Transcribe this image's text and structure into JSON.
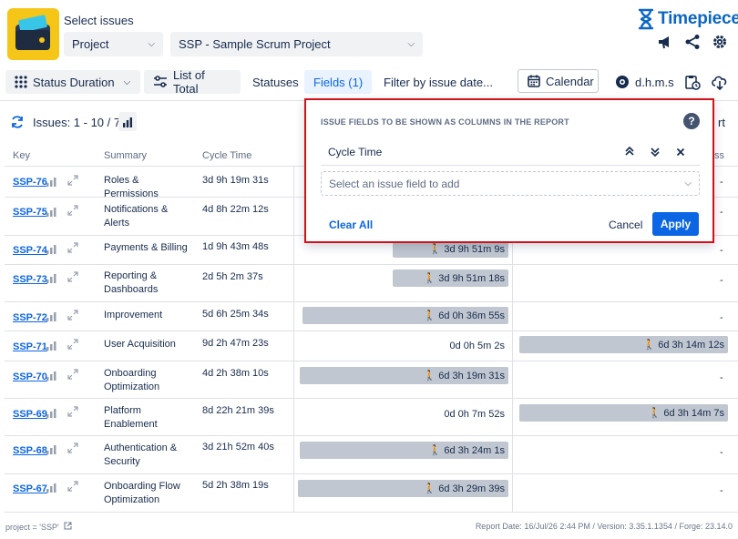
{
  "header": {
    "select_label": "Select issues",
    "project_dropdown": "Project",
    "project_value": "SSP - Sample Scrum Project",
    "brand_name": "Timepiece"
  },
  "toolbar": {
    "status_duration": "Status Duration",
    "list_of_total": "List of Total",
    "statuses": "Statuses",
    "fields": "Fields (1)",
    "filter": "Filter by issue date...",
    "calendar": "Calendar",
    "time_format": "d.h.m.s"
  },
  "issues": {
    "count": "Issues: 1 - 10 / 76",
    "partial_right": "rt",
    "partial_col": "ss"
  },
  "table": {
    "headers": {
      "key": "Key",
      "summary": "Summary",
      "cycle_time": "Cycle Time"
    },
    "rows": [
      {
        "key": "SSP-76",
        "summary": "Roles & Permissions",
        "cycle": "3d 9h 19m 31s",
        "mid": "",
        "right": "-"
      },
      {
        "key": "SSP-75",
        "summary": "Notifications & Alerts",
        "cycle": "4d 8h 22m 12s",
        "mid": "",
        "right": "-"
      },
      {
        "key": "SSP-74",
        "summary": "Payments & Billing",
        "cycle": "1d 9h 43m 48s",
        "mid": "3d 9h 51m 9s",
        "right": "-"
      },
      {
        "key": "SSP-73",
        "summary": "Reporting & Dashboards",
        "cycle": "2d 5h 2m 37s",
        "mid": "3d 9h 51m 18s",
        "right": "-"
      },
      {
        "key": "SSP-72",
        "summary": "Improvement",
        "cycle": "5d 6h 25m 34s",
        "mid": "6d 0h 36m 55s",
        "right": "-"
      },
      {
        "key": "SSP-71",
        "summary": "User Acquisition",
        "cycle": "9d 2h 47m 23s",
        "mid": "0d 0h 5m 2s",
        "right": "6d 3h 14m 12s"
      },
      {
        "key": "SSP-70",
        "summary": "Onboarding Optimization",
        "cycle": "4d 2h 38m 10s",
        "mid": "6d 3h 19m 31s",
        "right": "-"
      },
      {
        "key": "SSP-69",
        "summary": "Platform Enablement",
        "cycle": "8d 22h 21m 39s",
        "mid": "0d 0h 7m 52s",
        "right": "6d 3h 14m 7s"
      },
      {
        "key": "SSP-68",
        "summary": "Authentication & Security",
        "cycle": "3d 21h 52m 40s",
        "mid": "6d 3h 24m 1s",
        "right": "-"
      },
      {
        "key": "SSP-67",
        "summary": "Onboarding Flow Optimization",
        "cycle": "5d 2h 38m 19s",
        "mid": "6d 3h 29m 39s",
        "right": "-"
      }
    ]
  },
  "popup": {
    "title": "ISSUE FIELDS TO BE SHOWN AS COLUMNS IN THE REPORT",
    "field": "Cycle Time",
    "select_placeholder": "Select an issue field to add",
    "clear_all": "Clear All",
    "cancel": "Cancel",
    "apply": "Apply"
  },
  "footer": {
    "query": "project = 'SSP'",
    "report_info": "Report Date: 16/Jul/26 2:44 PM / Version: 3.35.1.1354 / Forge: 23.14.0"
  },
  "colors": {
    "accent": "#0c66e4",
    "popup_border": "#d0121b",
    "bar": "#c1c7d0",
    "brand": "#0b66c3"
  }
}
